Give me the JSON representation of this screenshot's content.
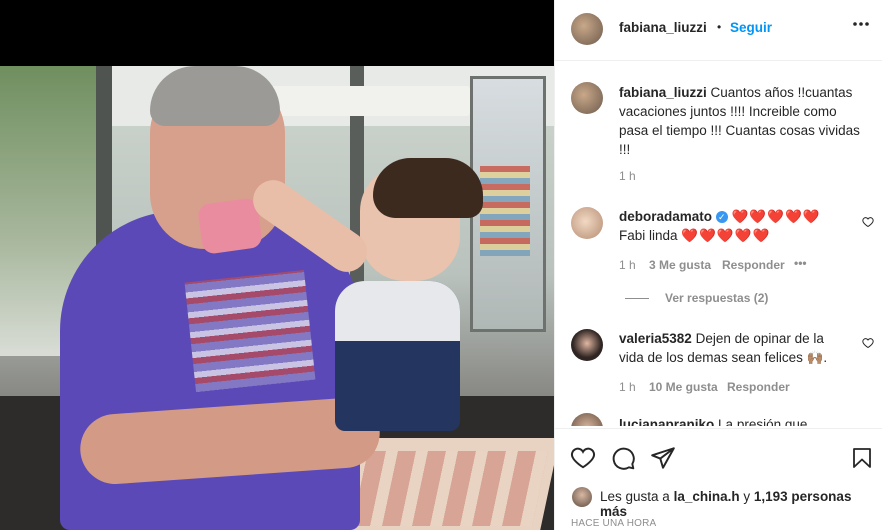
{
  "post": {
    "username": "fabiana_liuzzi",
    "separator": "•",
    "follow_label": "Seguir",
    "more_icon": "more-horizontal-icon"
  },
  "caption": {
    "username": "fabiana_liuzzi",
    "text": "Cuantos años !!cuantas vacaciones juntos !!!! Increible como pasa el tiempo !!! Cuantas cosas vividas !!!",
    "time": "1 h"
  },
  "comments": [
    {
      "username": "deboradamato",
      "verified": true,
      "text_line1": "❤️❤️❤️❤️❤️",
      "text_line2_prefix": "Fabi linda",
      "text_line2_hearts": "❤️❤️❤️❤️❤️",
      "time": "1 h",
      "likes": "3 Me gusta",
      "reply_label": "Responder",
      "more": "•••",
      "view_replies": "Ver respuestas (2)"
    },
    {
      "username": "valeria5382",
      "text": "Dejen de opinar de la vida de los demas sean felices 🙌🏽.",
      "time": "1 h",
      "likes": "10 Me gusta",
      "reply_label": "Responder"
    },
    {
      "username": "lucianapraniko",
      "text": "La presión que"
    }
  ],
  "likes_bar": {
    "prefix": "Les gusta a",
    "user": "la_china.h",
    "conj": "y",
    "count": "1,193 personas más"
  },
  "timestamp": "HACE UNA HORA",
  "icons": [
    "heart-icon",
    "comment-icon",
    "share-icon",
    "bookmark-icon"
  ],
  "colors": {
    "link": "#0095f6",
    "heart": "#ed4956",
    "muted": "#8e8e8e",
    "text": "#262626"
  }
}
